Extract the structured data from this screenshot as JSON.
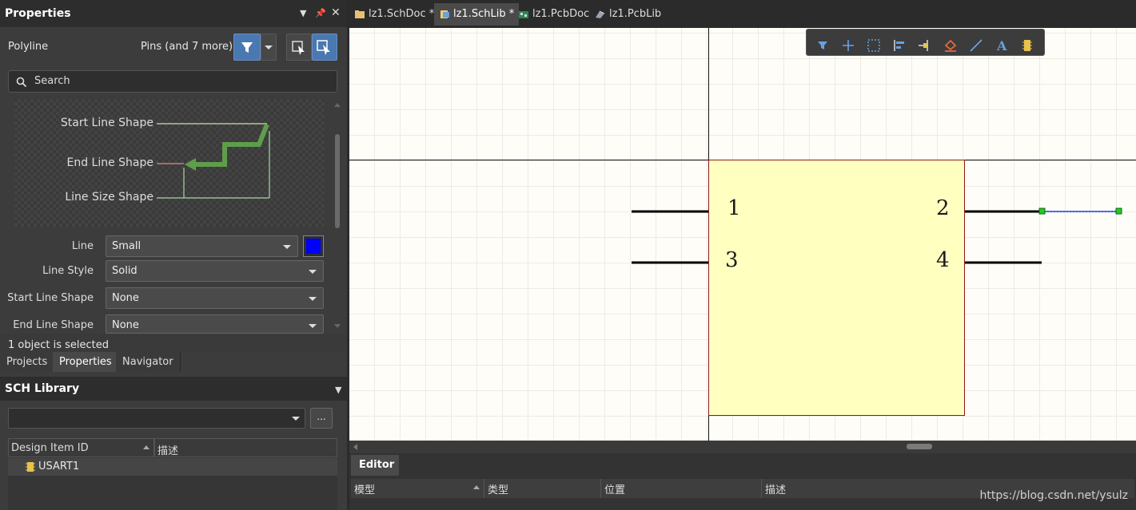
{
  "properties_panel": {
    "title": "Properties",
    "object_type": "Polyline",
    "filter_summary": "Pins (and 7 more)",
    "search_placeholder": "Search",
    "diagram_labels": {
      "start": "Start Line Shape",
      "end": "End Line Shape",
      "size": "Line Size Shape"
    },
    "fields": [
      {
        "label": "Line",
        "value": "Small",
        "color": "#0000ff"
      },
      {
        "label": "Line Style",
        "value": "Solid"
      },
      {
        "label": "Start Line Shape",
        "value": "None"
      },
      {
        "label": "End Line Shape",
        "value": "None"
      }
    ],
    "status": "1 object is selected",
    "tabs": [
      "Projects",
      "Properties",
      "Navigator"
    ],
    "active_tab": "Properties"
  },
  "sch_library": {
    "title": "SCH Library",
    "more_button": "...",
    "columns": [
      "Design Item ID",
      "描述"
    ],
    "items": [
      {
        "id": "USART1",
        "description": ""
      }
    ]
  },
  "document_tabs": [
    {
      "label": "lz1.SchDoc *",
      "icon": "schdoc-icon"
    },
    {
      "label": "lz1.SchLib *",
      "icon": "schlib-icon",
      "active": true
    },
    {
      "label": "lz1.PcbDoc",
      "icon": "pcbdoc-icon"
    },
    {
      "label": "lz1.PcbLib",
      "icon": "pcblib-icon"
    }
  ],
  "canvas": {
    "component_fill": "#ffffc0",
    "pins": [
      "1",
      "2",
      "3",
      "4"
    ]
  },
  "toolbar_icons": [
    "filter-icon",
    "crosshair-add-icon",
    "select-rect-icon",
    "align-icon",
    "pin-icon",
    "fill-icon",
    "line-icon",
    "text-icon",
    "component-icon"
  ],
  "editor_panel": {
    "tab": "Editor",
    "columns": [
      "模型",
      "类型",
      "位置",
      "描述"
    ]
  },
  "watermark": "https://blog.csdn.net/ysulz",
  "colors": {
    "accent": "#4a78b0",
    "selection": "#3355ff",
    "handle": "#22cc22"
  }
}
